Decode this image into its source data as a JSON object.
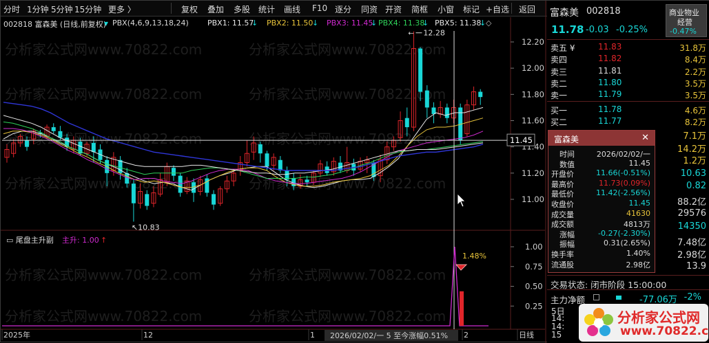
{
  "toolbar": {
    "items": [
      "分时",
      "1分钟",
      "5分钟",
      "15分钟",
      "更多 〉",
      "复权",
      "叠加",
      "多股",
      "统计",
      "画线",
      "F10",
      "逐分",
      "同资",
      "开资",
      "简框",
      "小窗",
      "标记",
      "+自选",
      "返回"
    ]
  },
  "chart": {
    "title": "002818 富森美 (日线,前复权)",
    "indicator_label": "PBX(4,6,9,13,18,24)",
    "pbx": [
      {
        "label": "PBX1: 11.57",
        "color": "#e8e8e8"
      },
      {
        "label": "PBX2: 11.50",
        "color": "#e8c43a"
      },
      {
        "label": "PBX3: 11.45",
        "color": "#d02ad0"
      },
      {
        "label": "PBX4: 11.38",
        "color": "#2fd25a"
      },
      {
        "label": "PBX5: 11.38",
        "color": "#e8e8e8"
      }
    ],
    "arrows": [
      "↓",
      "↓",
      "↓",
      "↓",
      "↓"
    ],
    "diamond": "◇",
    "y_ticks": [
      "12.20",
      "12.00",
      "11.80",
      "11.60",
      "11.40",
      "11.20",
      "11.00"
    ],
    "crosshair_price": "11.45",
    "hi_label": "12.28",
    "lo_label": "10.83",
    "x_labels": [
      "2025年",
      "12",
      "1",
      "2",
      "日线"
    ],
    "date_status": "2026/02/02/一  5  至今涨幅0.51%"
  },
  "chart_data": [
    {
      "type": "line",
      "title": "",
      "ylabel": "",
      "ylim": [
        10.78,
        12.3
      ],
      "series": [
        {
          "name": "PBX1",
          "values": [
            11.46,
            11.5,
            11.52,
            11.52,
            11.5,
            11.47,
            11.43,
            11.4,
            11.37,
            11.34,
            11.3,
            11.27,
            11.24,
            11.2,
            11.17,
            11.14,
            11.12,
            11.13,
            11.12,
            11.09,
            11.07,
            11.11,
            11.15,
            11.18,
            11.2,
            11.23,
            11.24,
            11.25,
            11.25,
            11.2,
            11.15,
            11.12,
            11.1,
            11.09,
            11.1,
            11.12,
            11.14,
            11.15,
            11.15,
            11.16,
            11.2,
            11.25,
            11.31,
            11.41,
            11.51,
            11.61,
            11.66,
            11.64,
            11.66,
            11.66,
            11.68,
            11.7
          ]
        },
        {
          "name": "PBX2",
          "values": [
            11.5,
            11.52,
            11.52,
            11.51,
            11.49,
            11.46,
            11.42,
            11.39,
            11.35,
            11.32,
            11.28,
            11.25,
            11.21,
            11.18,
            11.15,
            11.13,
            11.14,
            11.13,
            11.11,
            11.09,
            11.09,
            11.11,
            11.15,
            11.18,
            11.21,
            11.23,
            11.24,
            11.24,
            11.22,
            11.17,
            11.13,
            11.11,
            11.1,
            11.1,
            11.11,
            11.13,
            11.14,
            11.15,
            11.16,
            11.18,
            11.22,
            11.26,
            11.33,
            11.41,
            11.48,
            11.53,
            11.55,
            11.55,
            11.56,
            11.58,
            11.6,
            11.62
          ]
        },
        {
          "name": "PBX3",
          "values": [
            11.54,
            11.54,
            11.53,
            11.51,
            11.48,
            11.45,
            11.41,
            11.37,
            11.34,
            11.3,
            11.27,
            11.23,
            11.2,
            11.17,
            11.15,
            11.16,
            11.16,
            11.14,
            11.13,
            11.12,
            11.14,
            11.17,
            11.2,
            11.22,
            11.23,
            11.23,
            11.22,
            11.19,
            11.16,
            11.14,
            11.13,
            11.12,
            11.12,
            11.13,
            11.14,
            11.15,
            11.16,
            11.18,
            11.21,
            11.25,
            11.29,
            11.33,
            11.37,
            11.39,
            11.41,
            11.43,
            11.44,
            11.45,
            11.46,
            11.47,
            11.49,
            11.52
          ]
        },
        {
          "name": "PBX4",
          "values": [
            11.59,
            11.58,
            11.56,
            11.54,
            11.51,
            11.47,
            11.44,
            11.4,
            11.37,
            11.34,
            11.3,
            11.27,
            11.25,
            11.23,
            11.21,
            11.19,
            11.2,
            11.2,
            11.2,
            11.2,
            11.22,
            11.23,
            11.24,
            11.24,
            11.23,
            11.22,
            11.2,
            11.18,
            11.16,
            11.16,
            11.16,
            11.16,
            11.17,
            11.17,
            11.18,
            11.19,
            11.21,
            11.23,
            11.26,
            11.28,
            11.31,
            11.34,
            11.36,
            11.37,
            11.38,
            11.38,
            11.39,
            11.4,
            11.41,
            11.42,
            11.43,
            11.44
          ]
        },
        {
          "name": "PBX5",
          "values": [
            11.64,
            11.62,
            11.6,
            11.58,
            11.55,
            11.51,
            11.47,
            11.44,
            11.41,
            11.38,
            11.35,
            11.32,
            11.3,
            11.28,
            11.26,
            11.25,
            11.25,
            11.25,
            11.25,
            11.25,
            11.26,
            11.26,
            11.25,
            11.24,
            11.23,
            11.22,
            11.21,
            11.2,
            11.2,
            11.19,
            11.19,
            11.2,
            11.2,
            11.21,
            11.22,
            11.23,
            11.25,
            11.27,
            11.29,
            11.31,
            11.33,
            11.35,
            11.37,
            11.37,
            11.38,
            11.38,
            11.38,
            11.39,
            11.4,
            11.41,
            11.42,
            11.43
          ]
        },
        {
          "name": "PBX6",
          "values": [
            11.74,
            11.73,
            11.72,
            11.71,
            11.69,
            11.66,
            11.62,
            11.58,
            11.55,
            11.52,
            11.49,
            11.46,
            11.44,
            11.42,
            11.4,
            11.38,
            11.36,
            11.35,
            11.34,
            11.33,
            11.32,
            11.31,
            11.3,
            11.29,
            11.28,
            11.27,
            11.26,
            11.25,
            11.24,
            11.23,
            11.22,
            11.22,
            11.22,
            11.22,
            11.22,
            11.22,
            11.23,
            11.24,
            11.25,
            11.27,
            11.29,
            11.31,
            11.33,
            11.34,
            11.35,
            11.36,
            11.36,
            11.37,
            11.38,
            11.39,
            11.4,
            11.42
          ]
        }
      ]
    },
    {
      "type": "bar",
      "title": "尾盘主升副",
      "series_label": "主升: 1.00",
      "ylim": [
        0,
        1.05
      ],
      "y_ticks": [
        "1.00",
        "0.75",
        "0.50",
        "0.25"
      ],
      "line_values_peak": 1.0,
      "bar_value": 0.35,
      "annotation": "1.48%"
    }
  ],
  "sub": {
    "title": "尾盘主升副",
    "series_label": "主升: 1.00",
    "arrow": "↑",
    "annotation": "1.48%"
  },
  "right_panel": {
    "name": "富森美",
    "code": "002818",
    "price": "11.78",
    "change": "-0.03",
    "pct": "-0.25%",
    "industry": "商业物业",
    "industry2": "经营",
    "industry_pct": "-0.47%",
    "sell": [
      {
        "label": "卖五 ¥",
        "price": "11.83",
        "vol": "31.8万"
      },
      {
        "label": "卖四",
        "price": "11.82",
        "vol": "8.4万"
      },
      {
        "label": "卖三",
        "price": "11.81",
        "vol": "2.2万"
      },
      {
        "label": "卖二",
        "price": "11.80",
        "vol": "3.5万"
      },
      {
        "label": "卖一",
        "price": "11.79",
        "vol": "3.5万"
      }
    ],
    "buy": [
      {
        "label": "买一",
        "price": "11.78",
        "vol": "4.6万"
      },
      {
        "label": "买二",
        "price": "11.77",
        "vol": "8.2万"
      }
    ],
    "right_col": [
      "7.1万",
      "14.2万",
      "1.2万",
      "10.63",
      "0.82",
      "88.2亿",
      "29576",
      "14350",
      "7.48亿",
      "2.98亿",
      "13.9"
    ],
    "status_label": "交易状态: 闭市阶段 15:00:00",
    "flow_label": "主力净额",
    "flow_value": "-77.06万",
    "flow_pct": "-2%",
    "bottom_rows": [
      "5日",
      "14:",
      "14:",
      "15"
    ]
  },
  "popup": {
    "title": "富森美",
    "close": "✕",
    "rows": [
      {
        "label": "时间",
        "value": "2026/02/02/一"
      },
      {
        "label": "数值",
        "value": "11.45"
      },
      {
        "label": "开盘价",
        "value": "11.66(-0.51%)"
      },
      {
        "label": "最高价",
        "value": "11.73(0.09%)"
      },
      {
        "label": "最低价",
        "value": "11.42(-2.56%)"
      },
      {
        "label": "收盘价",
        "value": "11.45"
      },
      {
        "label": "成交量",
        "value": "41630"
      },
      {
        "label": "成交额",
        "value": "4813万"
      },
      {
        "label": "涨幅",
        "value": "-0.27(-2.30%)"
      },
      {
        "label": "振幅",
        "value": "0.31(2.65%)"
      },
      {
        "label": "换手率",
        "value": "1.40%"
      },
      {
        "label": "流通股",
        "value": "2.98亿"
      }
    ]
  },
  "watermark": "分析家公式网www.70822.com",
  "ad": {
    "brand": "分析家公式网",
    "url": "www.70822.com"
  },
  "colors": {
    "up": "#e0252a",
    "down": "#19d7d7",
    "bg": "#000000",
    "accent": "#e8c43a"
  }
}
